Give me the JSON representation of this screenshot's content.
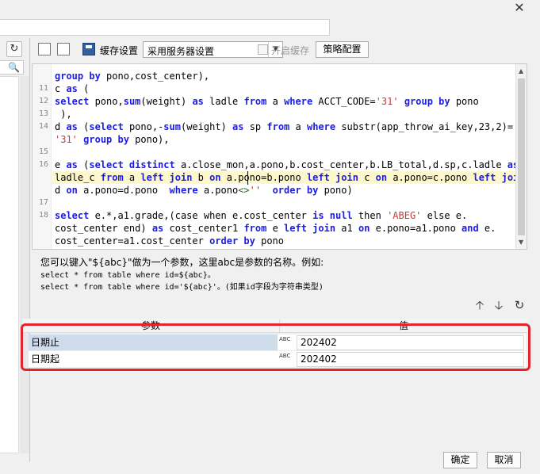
{
  "window": {
    "close_glyph": "✕"
  },
  "sidebar": {
    "refresh_glyph": "↻",
    "search_glyph": "🔍"
  },
  "toolbar": {
    "cache_label": "缓存设置",
    "cache_select_value": "采用服务器设置",
    "enable_cache_label": "开启缓存",
    "strategy_button": "策略配置"
  },
  "editor": {
    "lines": [
      {
        "n": "",
        "html": "<span class='kw'>group by</span> pono,cost_center),"
      },
      {
        "n": "11",
        "html": "c <span class='kw'>as</span> ("
      },
      {
        "n": "12",
        "html": "<span class='kw'>select</span> pono,<span class='kw'>sum</span>(weight) <span class='kw'>as</span> ladle <span class='kw'>from</span> a <span class='kw'>where</span> ACCT_CODE=<span class='str'>'31'</span> <span class='kw'>group by</span> pono"
      },
      {
        "n": "13",
        "html": " ),"
      },
      {
        "n": "14",
        "html": "d <span class='kw'>as</span> (<span class='kw'>select</span> pono,-<span class='kw'>sum</span>(weight) <span class='kw'>as</span> sp <span class='kw'>from</span> a <span class='kw'>where</span> substr(app_throw_ai_key,23,2)="
      },
      {
        "n": "",
        "html": "<span class='str'>'31'</span> <span class='kw'>group by</span> pono),"
      },
      {
        "n": "15",
        "html": ""
      },
      {
        "n": "16",
        "html": "e <span class='kw'>as</span> (<span class='kw'>select distinct</span> a.close_mon,a.pono,b.cost_center,b.LB_total,d.sp,c.ladle <span class='kw'>as</span>"
      },
      {
        "n": "",
        "html": "ladle_c <span class='kw'>from</span> a <span class='kw'>left join</span> b <span class='kw'>on</span> a.pono=b.pono <span class='kw'>left join</span> c <span class='kw'>on</span> a.pono=c.pono <span class='kw'>left join</span>"
      },
      {
        "n": "",
        "html": "d <span class='kw'>on</span> a.pono=d.pono  <span class='kw'>where</span> a.pono<span class='op'>&lt;&gt;</span><span class='str'>''</span>  <span class='kw'>order by</span> pono)"
      },
      {
        "n": "17",
        "html": ""
      },
      {
        "n": "18",
        "html": "<span class='kw'>select</span> e.*,a1.grade,(case when e.cost_center <span class='kw'>is null</span> then <span class='str'>'ABEG'</span> else e."
      },
      {
        "n": "",
        "html": "cost_center end) <span class='kw'>as</span> cost_center1 <span class='kw'>from</span> e <span class='kw'>left join</span> a1 <span class='kw'>on</span> e.pono=a1.pono <span class='kw'>and</span> e."
      },
      {
        "n": "",
        "html": "cost_center=a1.cost_center <span class='kw'>order by</span> pono"
      }
    ]
  },
  "help": {
    "main": "您可以键入\"${abc}\"做为一个参数，这里abc是参数的名称。例如:",
    "example1": "select * from table where id=${abc}。",
    "example2": "select * from table where id='${abc}'。(如果id字段为字符串类型)"
  },
  "param_tools": {
    "up": "🡡",
    "down": "🡣",
    "refresh": "↻"
  },
  "params": {
    "col_param": "参数",
    "col_value": "值",
    "type_badge": "ABC",
    "rows": [
      {
        "name": "日期止",
        "value": "202402"
      },
      {
        "name": "日期起",
        "value": "202402"
      }
    ]
  },
  "footer": {
    "ok": "确定",
    "cancel": "取消"
  }
}
